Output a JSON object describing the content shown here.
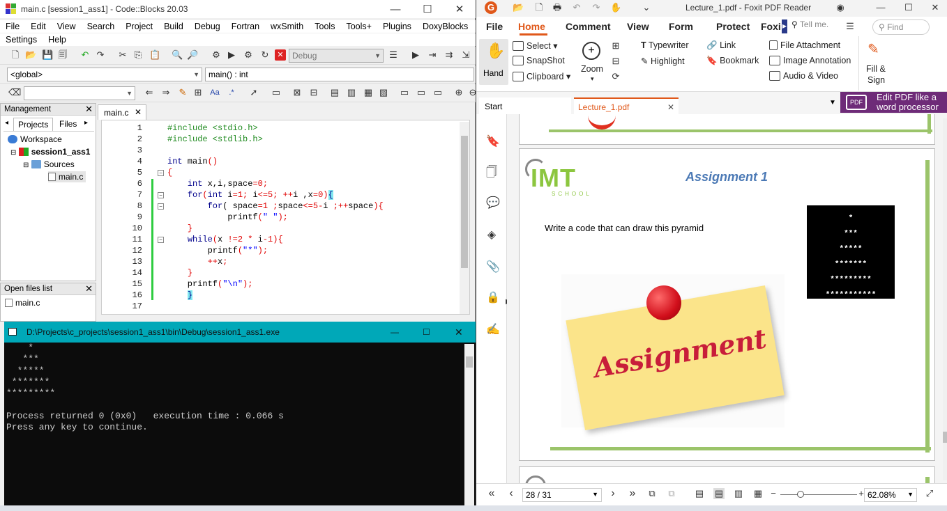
{
  "codeblocks": {
    "title": "main.c [session1_ass1] - Code::Blocks 20.03",
    "menu1": [
      "File",
      "Edit",
      "View",
      "Search",
      "Project",
      "Build",
      "Debug",
      "Fortran",
      "wxSmith",
      "Tools",
      "Tools+",
      "Plugins",
      "DoxyBlocks"
    ],
    "menu2": [
      "Settings",
      "Help"
    ],
    "build_target": "Debug",
    "scope": "<global>",
    "symbol": "main() : int",
    "management": {
      "title": "Management",
      "tabs": [
        "Projects",
        "Files"
      ],
      "tree": {
        "workspace": "Workspace",
        "project": "session1_ass1",
        "folder": "Sources",
        "file": "main.c"
      }
    },
    "open_files": {
      "title": "Open files list",
      "items": [
        "main.c"
      ]
    },
    "editor_tab": "main.c",
    "line_numbers": [
      "1",
      "2",
      "3",
      "4",
      "5",
      "6",
      "7",
      "8",
      "9",
      "10",
      "11",
      "12",
      "13",
      "14",
      "15",
      "16",
      "17"
    ],
    "code": [
      {
        "parts": [
          {
            "t": "#include <stdio.h>",
            "c": "pp"
          }
        ]
      },
      {
        "parts": [
          {
            "t": "#include <stdlib.h>",
            "c": "pp"
          }
        ]
      },
      {
        "parts": []
      },
      {
        "parts": [
          {
            "t": "int",
            "c": "kw"
          },
          {
            "t": " main"
          },
          {
            "t": "()",
            "c": "op"
          }
        ]
      },
      {
        "parts": [
          {
            "t": "{",
            "c": "op"
          }
        ]
      },
      {
        "parts": [
          {
            "t": "    "
          },
          {
            "t": "int",
            "c": "kw"
          },
          {
            "t": " x,i,space"
          },
          {
            "t": "=0;",
            "c": "op"
          }
        ]
      },
      {
        "parts": [
          {
            "t": "    "
          },
          {
            "t": "for",
            "c": "kw"
          },
          {
            "t": "(",
            "c": "op"
          },
          {
            "t": "int",
            "c": "kw"
          },
          {
            "t": " i"
          },
          {
            "t": "=1;",
            "c": "op"
          },
          {
            "t": " i"
          },
          {
            "t": "<=5;",
            "c": "op"
          },
          {
            "t": " "
          },
          {
            "t": "++",
            "c": "op"
          },
          {
            "t": "i ,x"
          },
          {
            "t": "=0)",
            "c": "op"
          },
          {
            "t": "{",
            "c": "hl"
          }
        ]
      },
      {
        "parts": [
          {
            "t": "        "
          },
          {
            "t": "for",
            "c": "kw"
          },
          {
            "t": "( space"
          },
          {
            "t": "=1 ;",
            "c": "op"
          },
          {
            "t": "space"
          },
          {
            "t": "<=5-",
            "c": "op"
          },
          {
            "t": "i "
          },
          {
            "t": ";++",
            "c": "op"
          },
          {
            "t": "space"
          },
          {
            "t": "){",
            "c": "op"
          }
        ]
      },
      {
        "parts": [
          {
            "t": "            printf"
          },
          {
            "t": "(",
            "c": "op"
          },
          {
            "t": "\" \"",
            "c": "str"
          },
          {
            "t": ");",
            "c": "op"
          }
        ]
      },
      {
        "parts": [
          {
            "t": "    "
          },
          {
            "t": "}",
            "c": "op"
          }
        ]
      },
      {
        "parts": [
          {
            "t": "    "
          },
          {
            "t": "while",
            "c": "kw"
          },
          {
            "t": "(",
            "c": "op"
          },
          {
            "t": "x "
          },
          {
            "t": "!=2 * ",
            "c": "op"
          },
          {
            "t": "i"
          },
          {
            "t": "-1){",
            "c": "op"
          }
        ]
      },
      {
        "parts": [
          {
            "t": "        printf"
          },
          {
            "t": "(",
            "c": "op"
          },
          {
            "t": "\"*\"",
            "c": "str"
          },
          {
            "t": ");",
            "c": "op"
          }
        ]
      },
      {
        "parts": [
          {
            "t": "        "
          },
          {
            "t": "++",
            "c": "op"
          },
          {
            "t": "x"
          },
          {
            "t": ";",
            "c": "op"
          }
        ]
      },
      {
        "parts": [
          {
            "t": "    "
          },
          {
            "t": "}",
            "c": "op"
          }
        ]
      },
      {
        "parts": [
          {
            "t": "    printf"
          },
          {
            "t": "(",
            "c": "op"
          },
          {
            "t": "\"\\n\"",
            "c": "str"
          },
          {
            "t": ");",
            "c": "op"
          }
        ]
      },
      {
        "parts": [
          {
            "t": "    "
          },
          {
            "t": "}",
            "c": "hl"
          }
        ]
      },
      {
        "parts": []
      }
    ]
  },
  "console": {
    "title": "D:\\Projects\\c_projects\\session1_ass1\\bin\\Debug\\session1_ass1.exe",
    "output": "    *\n   ***\n  *****\n *******\n*********\n\nProcess returned 0 (0x0)   execution time : 0.066 s\nPress any key to continue."
  },
  "foxit": {
    "title": "Lecture_1.pdf - Foxit PDF Reader",
    "menu": [
      "File",
      "Home",
      "Comment",
      "View",
      "Form",
      "Protect",
      "Foxi"
    ],
    "tell_me": "Tell me.",
    "find": "Find",
    "ribbon": {
      "hand": "Hand",
      "select": "Select",
      "snapshot": "SnapShot",
      "clipboard": "Clipboard",
      "zoom": "Zoom",
      "typewriter": "Typewriter",
      "highlight": "Highlight",
      "link": "Link",
      "bookmark": "Bookmark",
      "file_attachment": "File Attachment",
      "image_annotation": "Image Annotation",
      "audio_video": "Audio & Video",
      "fill_sign": "Fill &",
      "fill_sign2": "Sign"
    },
    "promo": "Edit PDF like a word processor",
    "tabs": [
      "Start",
      "Lecture_1.pdf"
    ],
    "page": {
      "logo": "IMT",
      "logo_sub": "SCHOOL",
      "heading": "Assignment 1",
      "instruction": "Write a code that can draw this pyramid",
      "sticky": "Assignment",
      "pyramid": [
        "*",
        "***",
        "*****",
        "*******",
        "*********",
        "***********"
      ]
    },
    "page_num": "28 / 31",
    "zoom": "62.08%"
  },
  "colors": {
    "console_bar": "#00a8b8",
    "foxit_accent": "#e0581a",
    "promo_bg": "#6e2b78",
    "pdf_title": "#4b79b5"
  }
}
